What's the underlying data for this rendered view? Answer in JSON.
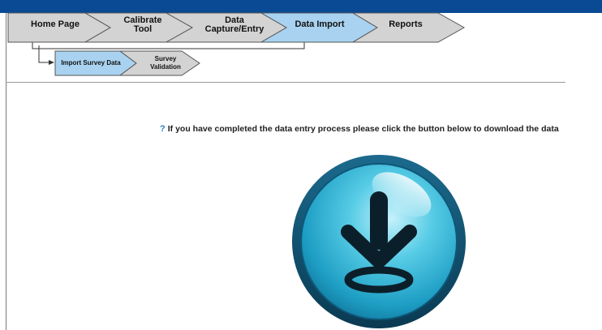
{
  "nav": {
    "tabs": [
      {
        "lines": [
          "Home Page"
        ]
      },
      {
        "lines": [
          "Calibrate",
          "Tool"
        ]
      },
      {
        "lines": [
          "Data",
          "Capture/Entry"
        ]
      },
      {
        "lines": [
          "Data Import"
        ],
        "active": true
      },
      {
        "lines": [
          "Reports"
        ]
      }
    ]
  },
  "subnav": {
    "tabs": [
      {
        "lines": [
          "Import Survey Data"
        ],
        "active": true
      },
      {
        "lines": [
          "Survey",
          "Validation"
        ]
      }
    ]
  },
  "content": {
    "help_symbol": "?",
    "prompt": "If you have completed the data entry process please click the button below to download the data"
  },
  "download_button": {
    "icon": "download-arrow-icon"
  },
  "colors": {
    "header_bar": "#0a4a95",
    "tab_active": "#a8d2f0",
    "tab_inactive": "#d3d3d3",
    "button_face": "#2fb3d6",
    "button_ring": "#13506e",
    "help_symbol": "#2a7fc8"
  }
}
